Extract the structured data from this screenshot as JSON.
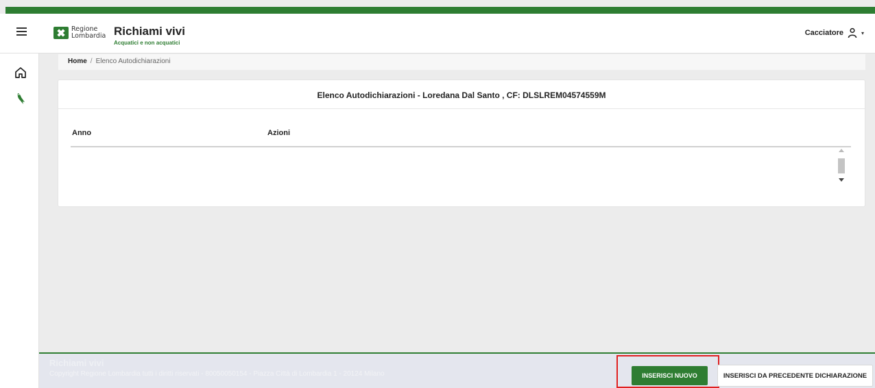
{
  "header": {
    "logo_line1": "Regione",
    "logo_line2": "Lombardia",
    "app_title": "Richiami vivi",
    "app_subtitle": "Acquatici e non acquatici",
    "user_name": "Cacciatore",
    "user_icon": "user-icon",
    "menu_icon": "hamburger-icon"
  },
  "sidebar": {
    "items": [
      {
        "icon": "home-icon"
      },
      {
        "icon": "bird-icon"
      }
    ]
  },
  "breadcrumb": {
    "home": "Home",
    "separator": "/",
    "current": "Elenco Autodichiarazioni"
  },
  "card": {
    "title": "Elenco Autodichiarazioni - Loredana Dal Santo , CF: DLSLREM04574559M",
    "columns": [
      "Anno",
      "Azioni"
    ],
    "rows": []
  },
  "footer": {
    "title": "Richiami vivi",
    "copyright": "Copyright Regione Lombardia tutti i diritti riservati - 80050050154 - Piazza Città di Lombardia 1 - 20124 Milano"
  },
  "actions": {
    "primary_label": "INSERISCI NUOVO",
    "secondary_label": "INSERISCI DA PRECEDENTE DICHIARAZIONE"
  },
  "colors": {
    "brand_green": "#2e7d32",
    "highlight_red": "#e02020"
  }
}
